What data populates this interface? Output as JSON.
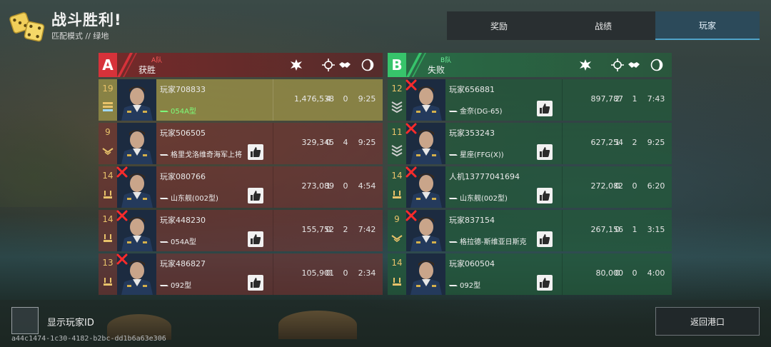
{
  "header": {
    "title": "战斗胜利!",
    "subtitle": "匹配模式 // 绿地"
  },
  "tabs": [
    {
      "label": "奖励",
      "active": false
    },
    {
      "label": "战绩",
      "active": false
    },
    {
      "label": "玩家",
      "active": true
    }
  ],
  "team_a": {
    "badge": "A",
    "name": "A队",
    "result": "获胜",
    "color": "#d7323a",
    "players": [
      {
        "level": "19",
        "name": "玩家708833",
        "ship": "054A型",
        "ship_highlight": true,
        "score": "1,476,538",
        "kills": "4",
        "assists": "0",
        "time": "9:25",
        "dead": false,
        "mvp": true,
        "rank_icon": "ribbon-rank-icon",
        "like": false
      },
      {
        "level": "9",
        "name": "玩家506505",
        "ship": "格里戈洛维奇海军上将",
        "ship_highlight": false,
        "score": "329,345",
        "kills": "0",
        "assists": "4",
        "time": "9:25",
        "dead": false,
        "mvp": false,
        "rank_icon": "chevron-rank-icon",
        "like": true
      },
      {
        "level": "14",
        "name": "玩家080766",
        "ship": "山东舰(002型)",
        "ship_highlight": false,
        "score": "273,089",
        "kills": "1",
        "assists": "0",
        "time": "4:54",
        "dead": true,
        "mvp": false,
        "rank_icon": "bar-rank-icon",
        "like": true
      },
      {
        "level": "14",
        "name": "玩家448230",
        "ship": "054A型",
        "ship_highlight": false,
        "score": "155,752",
        "kills": "0",
        "assists": "2",
        "time": "7:42",
        "dead": true,
        "mvp": false,
        "rank_icon": "bar-rank-icon",
        "like": true
      },
      {
        "level": "13",
        "name": "玩家486827",
        "ship": "092型",
        "ship_highlight": false,
        "score": "105,901",
        "kills": "0",
        "assists": "0",
        "time": "2:34",
        "dead": true,
        "mvp": false,
        "rank_icon": "bar-rank-icon",
        "like": true
      }
    ]
  },
  "team_b": {
    "badge": "B",
    "name": "B队",
    "result": "失败",
    "color": "#37c46b",
    "players": [
      {
        "level": "12",
        "name": "玩家656881",
        "ship": "金奈(DG-65)",
        "ship_highlight": false,
        "score": "897,787",
        "kills": "2",
        "assists": "1",
        "time": "7:43",
        "dead": true,
        "mvp": false,
        "rank_icon": "chevron-stack-rank-icon",
        "like": true
      },
      {
        "level": "11",
        "name": "玩家353243",
        "ship": "星座(FFG(X))",
        "ship_highlight": false,
        "score": "627,254",
        "kills": "1",
        "assists": "2",
        "time": "9:25",
        "dead": true,
        "mvp": false,
        "rank_icon": "chevron-stack-rank-icon",
        "like": true
      },
      {
        "level": "14",
        "name": "人机13777041694",
        "ship": "山东舰(002型)",
        "ship_highlight": false,
        "score": "272,082",
        "kills": "0",
        "assists": "0",
        "time": "6:20",
        "dead": true,
        "mvp": false,
        "rank_icon": "bar-rank-icon",
        "like": true
      },
      {
        "level": "9",
        "name": "玩家837154",
        "ship": "格拉德-斯维亚日斯克",
        "ship_highlight": false,
        "score": "267,156",
        "kills": "0",
        "assists": "1",
        "time": "3:15",
        "dead": true,
        "mvp": false,
        "rank_icon": "chevron-rank-icon",
        "like": true
      },
      {
        "level": "14",
        "name": "玩家060504",
        "ship": "092型",
        "ship_highlight": false,
        "score": "80,000",
        "kills": "0",
        "assists": "0",
        "time": "4:00",
        "dead": false,
        "mvp": false,
        "rank_icon": "bar-rank-icon",
        "like": true
      }
    ]
  },
  "columns": {
    "score_icon": "explosion-icon",
    "kills_icon": "crosshair-icon",
    "assists_icon": "handshake-icon",
    "time_icon": "clock-icon"
  },
  "footer": {
    "show_id_label": "显示玩家ID",
    "uid": "a44c1474-1c30-4182-b2bc-dd1b6a63e306",
    "back_label": "返回港口"
  }
}
